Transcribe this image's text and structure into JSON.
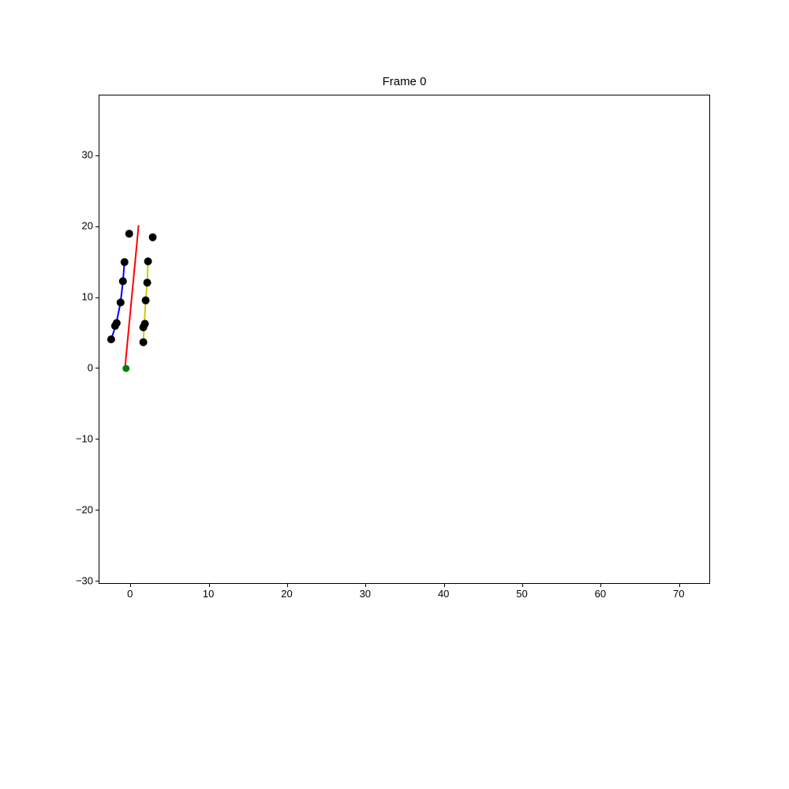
{
  "chart_data": {
    "type": "scatter",
    "title": "Frame 0",
    "xlabel": "",
    "ylabel": "",
    "xlim": [
      -4,
      74
    ],
    "ylim": [
      -30.5,
      38.5
    ],
    "xticks": [
      0,
      10,
      20,
      30,
      40,
      50,
      60,
      70
    ],
    "yticks": [
      -30,
      -20,
      -10,
      0,
      10,
      20,
      30
    ],
    "series": [
      {
        "name": "red-line",
        "type": "line",
        "color": "#ff0000",
        "points": [
          [
            -0.7,
            0.5
          ],
          [
            1.0,
            20.2
          ]
        ]
      },
      {
        "name": "blue-line",
        "type": "line",
        "color": "#0000ff",
        "points": [
          [
            -2.5,
            4.1
          ],
          [
            -1.9,
            6.1
          ],
          [
            -1.3,
            9.3
          ],
          [
            -1.0,
            12.3
          ],
          [
            -0.8,
            15.0
          ]
        ]
      },
      {
        "name": "yellow-line",
        "type": "line",
        "color": "#cccc00",
        "points": [
          [
            1.6,
            3.7
          ],
          [
            1.7,
            5.8
          ],
          [
            1.9,
            9.6
          ],
          [
            2.1,
            12.1
          ],
          [
            2.2,
            15.1
          ]
        ]
      },
      {
        "name": "green-line",
        "type": "line",
        "color": "#008000",
        "points": [
          [
            -0.7,
            0.5
          ],
          [
            -0.6,
            0.0
          ]
        ]
      },
      {
        "name": "black-dots",
        "type": "scatter",
        "color": "#000000",
        "points": [
          [
            -2.5,
            4.1
          ],
          [
            -2.0,
            6.0
          ],
          [
            -1.8,
            6.4
          ],
          [
            -1.3,
            9.3
          ],
          [
            -1.0,
            12.3
          ],
          [
            -0.8,
            15.0
          ],
          [
            -0.2,
            19.0
          ],
          [
            2.8,
            18.5
          ],
          [
            2.2,
            15.1
          ],
          [
            2.1,
            12.1
          ],
          [
            1.9,
            9.6
          ],
          [
            1.8,
            6.3
          ],
          [
            1.6,
            5.8
          ],
          [
            1.6,
            3.7
          ]
        ]
      },
      {
        "name": "green-dot",
        "type": "scatter",
        "color": "#008000",
        "points": [
          [
            -0.6,
            0.0
          ]
        ]
      }
    ]
  }
}
